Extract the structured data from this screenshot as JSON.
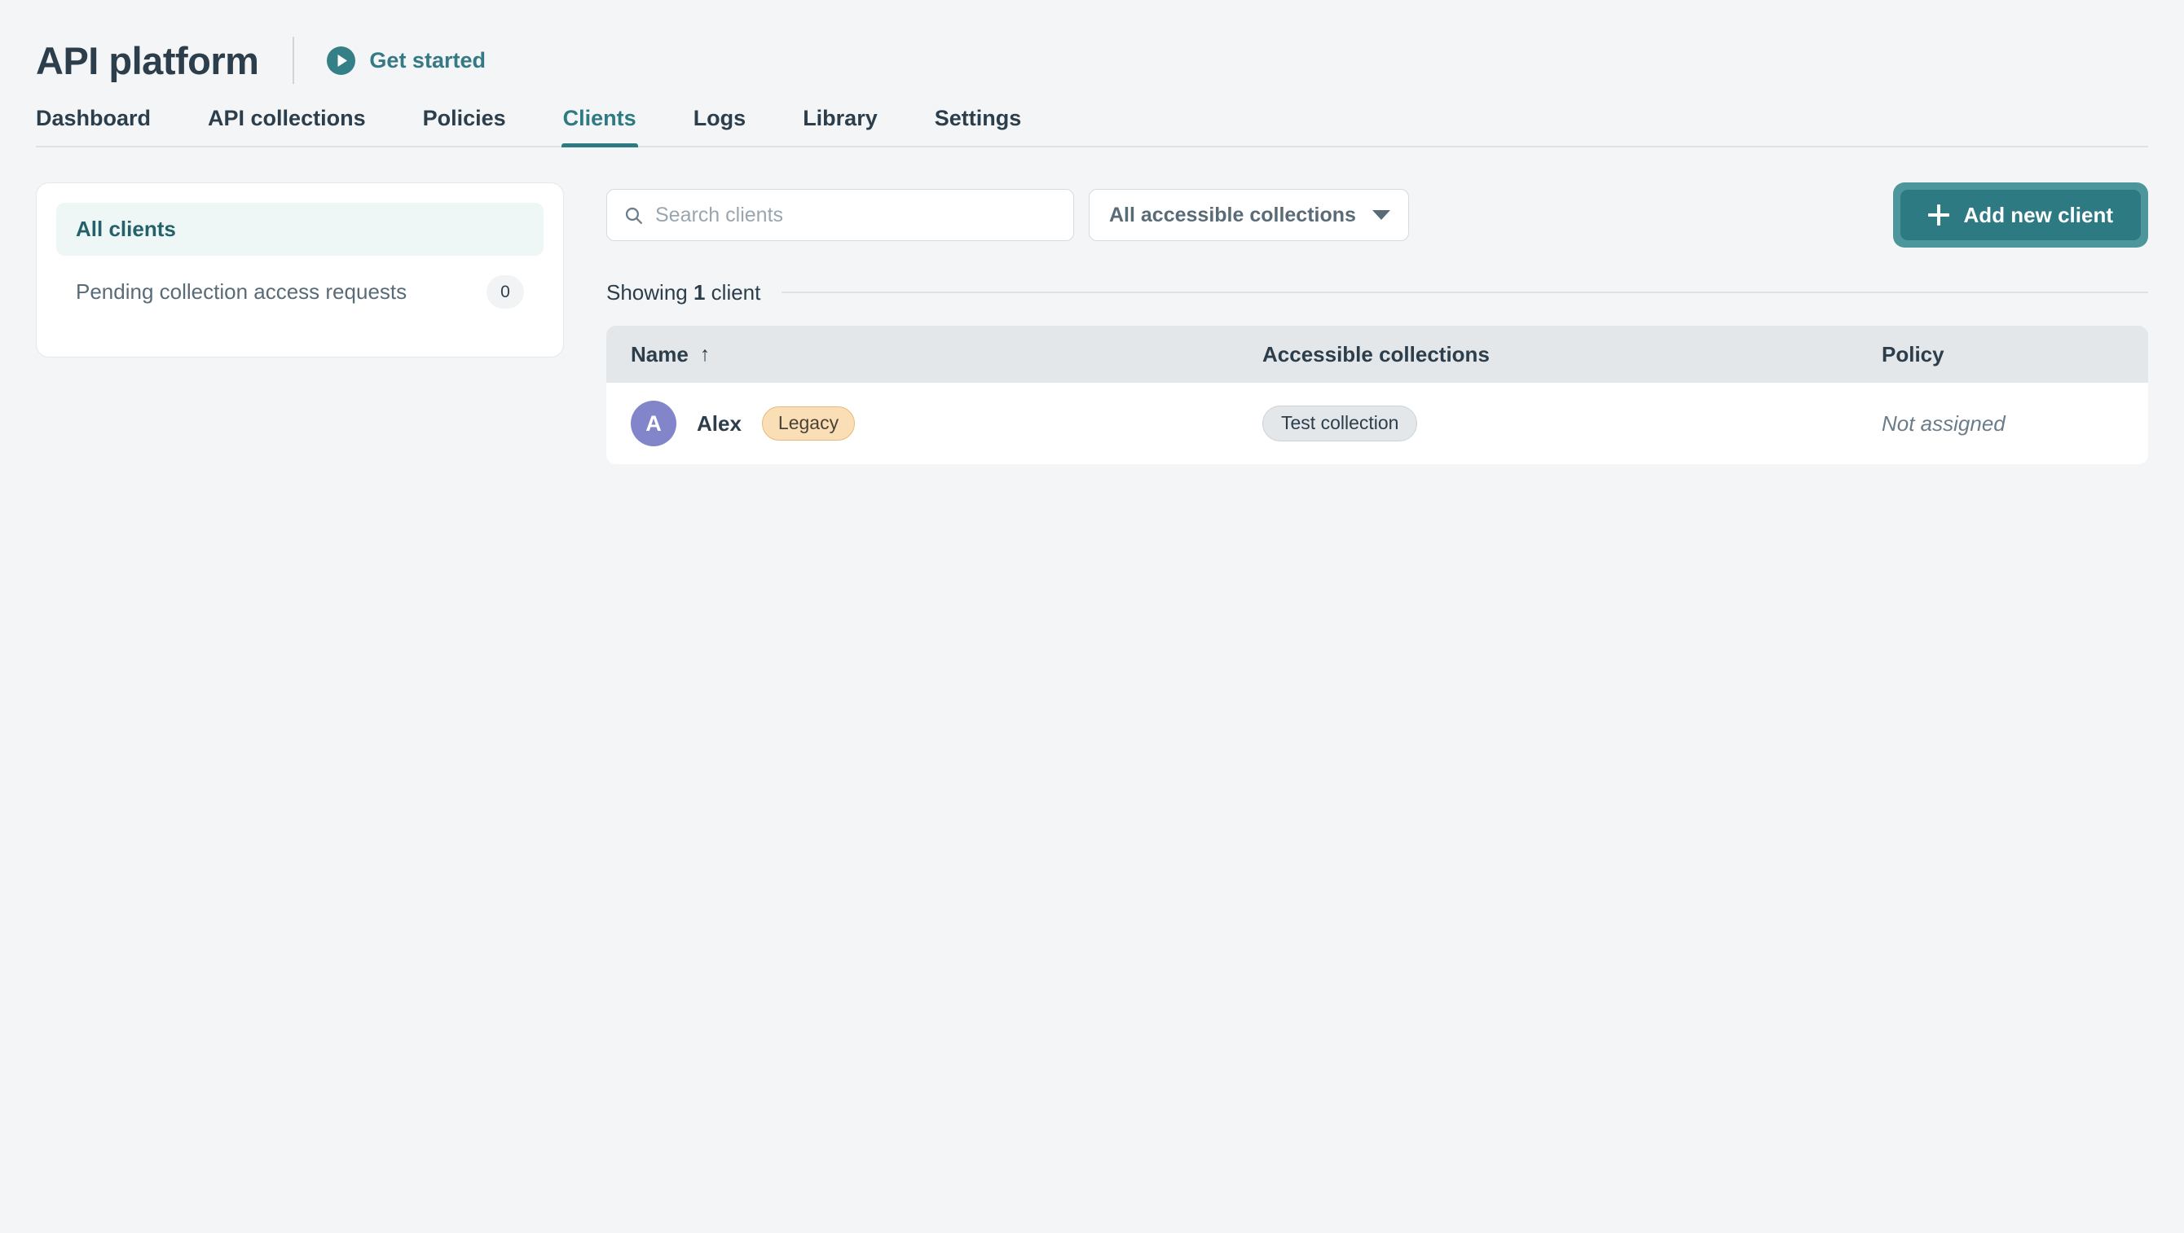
{
  "header": {
    "title": "API platform",
    "get_started_label": "Get started",
    "play_icon": "play-circle-icon",
    "accent_teal": "#2E7A83"
  },
  "tabs": [
    {
      "label": "Dashboard",
      "active": false
    },
    {
      "label": "API collections",
      "active": false
    },
    {
      "label": "Policies",
      "active": false
    },
    {
      "label": "Clients",
      "active": true
    },
    {
      "label": "Logs",
      "active": false
    },
    {
      "label": "Library",
      "active": false
    },
    {
      "label": "Settings",
      "active": false
    }
  ],
  "sidebar": {
    "items": [
      {
        "label": "All clients",
        "active": true,
        "count": null
      },
      {
        "label": "Pending collection access requests",
        "active": false,
        "count": "0"
      }
    ]
  },
  "toolbar": {
    "search": {
      "icon": "search-icon",
      "value": "",
      "placeholder": "Search clients"
    },
    "filter": {
      "icon": "chevron-down-icon",
      "selected": "All accessible collections"
    },
    "add_button": {
      "icon": "plus-icon",
      "label": "Add new client"
    }
  },
  "results": {
    "showing_prefix": "Showing ",
    "showing_count": "1",
    "showing_suffix": " client"
  },
  "table": {
    "columns": [
      {
        "label": "Name",
        "sort": "↑"
      },
      {
        "label": "Accessible collections"
      },
      {
        "label": "Policy"
      }
    ],
    "rows": [
      {
        "avatar_initial": "A",
        "avatar_color": "#8285CA",
        "name": "Alex",
        "badge": "Legacy",
        "collections": [
          "Test collection"
        ],
        "policy": "Not assigned"
      }
    ]
  }
}
